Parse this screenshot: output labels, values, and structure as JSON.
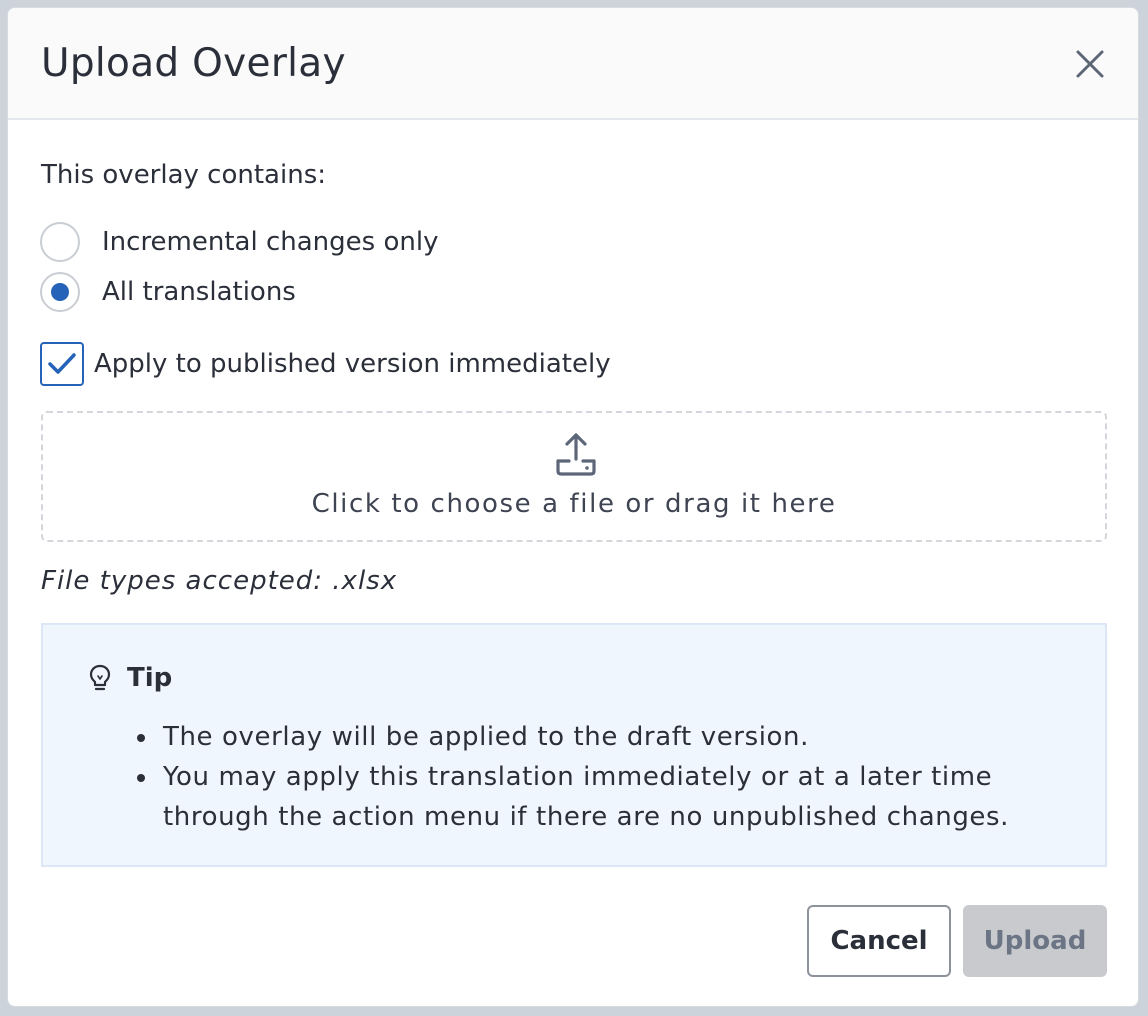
{
  "dialog": {
    "title": "Upload Overlay",
    "close_icon": "close-icon"
  },
  "overlay_type": {
    "label": "This overlay contains:",
    "options": [
      {
        "label": "Incremental changes only",
        "selected": false
      },
      {
        "label": "All translations",
        "selected": true
      }
    ]
  },
  "apply_immediately": {
    "label": "Apply to published version immediately",
    "checked": true
  },
  "dropzone": {
    "icon": "upload-icon",
    "text": "Click to choose a file or drag it here"
  },
  "file_types_text": "File types accepted: .xlsx",
  "tip": {
    "icon": "lightbulb-icon",
    "title": "Tip",
    "items": [
      "The overlay will be applied to the draft version.",
      "You may apply this translation immediately or at a later time through the action menu if there are no unpublished changes."
    ]
  },
  "buttons": {
    "cancel": "Cancel",
    "upload": "Upload",
    "upload_disabled": true
  },
  "colors": {
    "accent": "#2563b8",
    "tip_background": "#f0f6fe",
    "disabled_button": "#c8cacd"
  }
}
